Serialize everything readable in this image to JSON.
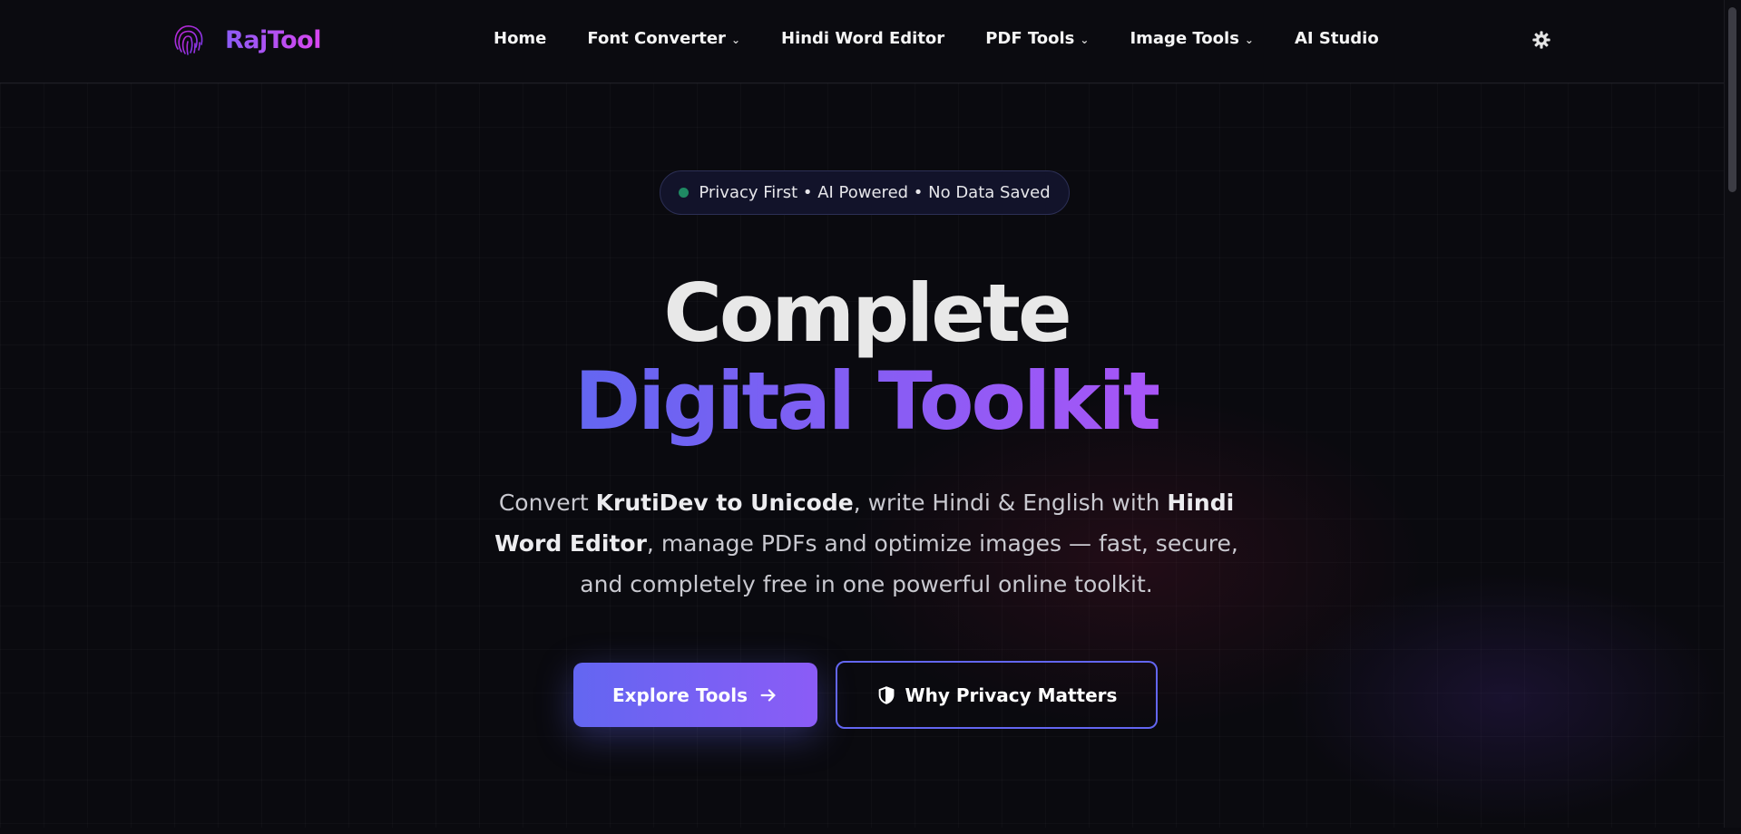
{
  "header": {
    "logo_text": "RajTool",
    "logo_icon": "fingerprint-icon",
    "nav": [
      {
        "label": "Home",
        "has_dropdown": false
      },
      {
        "label": "Font Converter",
        "has_dropdown": true
      },
      {
        "label": "Hindi Word Editor",
        "has_dropdown": false
      },
      {
        "label": "PDF Tools",
        "has_dropdown": true
      },
      {
        "label": "Image Tools",
        "has_dropdown": true
      },
      {
        "label": "AI Studio",
        "has_dropdown": false
      }
    ],
    "theme_icon": "gear-icon"
  },
  "hero": {
    "badge": "Privacy First • AI Powered • No Data Saved",
    "title_line1": "Complete",
    "title_line2": "Digital Toolkit",
    "subtitle": {
      "p1": "Convert ",
      "b1": "KrutiDev to Unicode",
      "p2": ", write Hindi & English with ",
      "b2": "Hindi Word Editor",
      "p3": ", manage PDFs and optimize images — fast, secure, and completely free in one powerful online toolkit."
    },
    "primary_button": "Explore Tools",
    "secondary_button": "Why Privacy Matters"
  },
  "colors": {
    "background": "#0a0a0f",
    "accent_start": "#6366f1",
    "accent_end": "#a855f7",
    "badge_dot": "#1f8a63",
    "logo_gradient_start": "#8b5cf6",
    "logo_gradient_end": "#d946ef"
  }
}
